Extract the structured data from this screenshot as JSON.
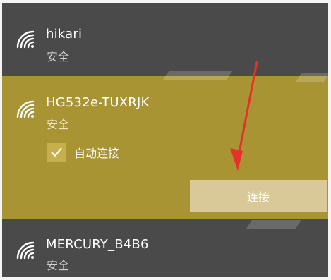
{
  "networks": [
    {
      "ssid": "hikari",
      "security": "安全",
      "icon": "wifi-icon"
    },
    {
      "ssid": "HG532e-TUXRJK",
      "security": "安全",
      "icon": "wifi-icon",
      "auto_connect_label": "自动连接",
      "auto_connect_checked": true,
      "connect_label": "连接"
    },
    {
      "ssid": "MERCURY_B4B6",
      "security": "安全",
      "icon": "wifi-icon"
    }
  ],
  "colors": {
    "panel_bg": "#4a4a4a",
    "selected_bg": "#a99433",
    "connect_button": "#d9c998",
    "annotation_arrow": "#e8302a"
  }
}
